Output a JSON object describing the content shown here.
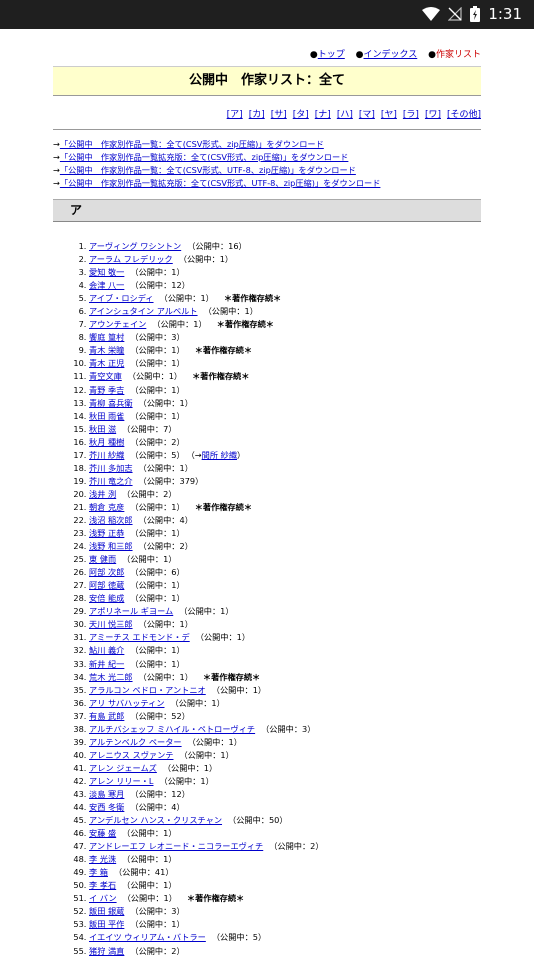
{
  "status_bar": {
    "time": "1:31",
    "icons": [
      "wifi-icon",
      "no-signal-icon",
      "battery-icon"
    ]
  },
  "topnav": [
    {
      "label": "トップ",
      "link": true
    },
    {
      "label": "インデックス",
      "link": true
    },
    {
      "label": "作家リスト",
      "link": false
    }
  ],
  "bullet": "●",
  "title": "公開中　作家リスト：全て",
  "kana": [
    "[ア]",
    "[カ]",
    "[サ]",
    "[タ]",
    "[ナ]",
    "[ハ]",
    "[マ]",
    "[ヤ]",
    "[ラ]",
    "[ワ]",
    "[その他]"
  ],
  "downloads": [
    {
      "arrow": "→",
      "text": "「公開中　作家別作品一覧：全て(CSV形式、zip圧縮)」をダウンロード"
    },
    {
      "arrow": "→",
      "text": "「公開中　作家別作品一覧拡充版：全て(CSV形式、zip圧縮)」をダウンロード"
    },
    {
      "arrow": "→",
      "text": "「公開中　作家別作品一覧：全て(CSV形式、UTF-8、zip圧縮)」をダウンロード"
    },
    {
      "arrow": "→",
      "text": "「公開中　作家別作品一覧拡充版：全て(CSV形式、UTF-8、zip圧縮)」をダウンロード"
    }
  ],
  "section_title": "ア",
  "authors": [
    {
      "name": "アーヴィング ワシントン",
      "count": "（公開中：16）"
    },
    {
      "name": "アーラム フレデリック",
      "count": "（公開中：1）"
    },
    {
      "name": "愛知 敬一",
      "count": "（公開中：1）"
    },
    {
      "name": "会津 八一",
      "count": "（公開中：12）"
    },
    {
      "name": "アイブ・ロシディ",
      "count": "（公開中：1）",
      "note": "＊著作権存続＊"
    },
    {
      "name": "アインシュタイン アルベルト",
      "count": "（公開中：1）"
    },
    {
      "name": "アウンチェイン",
      "count": "（公開中：1）",
      "note": "＊著作権存続＊"
    },
    {
      "name": "饗庭 篁村",
      "count": "（公開中：3）"
    },
    {
      "name": "青木 栄瞳",
      "count": "（公開中：1）",
      "note": "＊著作権存続＊"
    },
    {
      "name": "青木 正児",
      "count": "（公開中：1）"
    },
    {
      "name": "青空文庫",
      "count": "（公開中：1）",
      "note": "＊著作権存続＊"
    },
    {
      "name": "青野 季吉",
      "count": "（公開中：1）"
    },
    {
      "name": "青柳 喜兵衛",
      "count": "（公開中：1）"
    },
    {
      "name": "秋田 雨雀",
      "count": "（公開中：1）"
    },
    {
      "name": "秋田 滋",
      "count": "（公開中：7）"
    },
    {
      "name": "秋月 種樹",
      "count": "（公開中：2）"
    },
    {
      "name": "芥川 紗織",
      "count": "（公開中：5）",
      "ref_prefix": "（→",
      "ref": "間所 紗織",
      "ref_suffix": "）"
    },
    {
      "name": "芥川 多加志",
      "count": "（公開中：1）"
    },
    {
      "name": "芥川 竜之介",
      "count": "（公開中：379）"
    },
    {
      "name": "浅井 洌",
      "count": "（公開中：2）"
    },
    {
      "name": "朝倉 克彦",
      "count": "（公開中：1）",
      "note": "＊著作権存続＊"
    },
    {
      "name": "浅沼 稲次郎",
      "count": "（公開中：4）"
    },
    {
      "name": "浅野 正恭",
      "count": "（公開中：1）"
    },
    {
      "name": "浅野 和三郎",
      "count": "（公開中：2）"
    },
    {
      "name": "東 健而",
      "count": "（公開中：1）"
    },
    {
      "name": "阿部 次郎",
      "count": "（公開中：6）"
    },
    {
      "name": "阿部 徳蔵",
      "count": "（公開中：1）"
    },
    {
      "name": "安倍 能成",
      "count": "（公開中：1）"
    },
    {
      "name": "アポリネール ギヨーム",
      "count": "（公開中：1）"
    },
    {
      "name": "天川 悦三郎",
      "count": "（公開中：1）"
    },
    {
      "name": "アミーチス エドモンド・デ",
      "count": "（公開中：1）"
    },
    {
      "name": "鮎川 義介",
      "count": "（公開中：1）"
    },
    {
      "name": "新井 紀一",
      "count": "（公開中：1）"
    },
    {
      "name": "荒木 光二郎",
      "count": "（公開中：1）",
      "note": "＊著作権存続＊"
    },
    {
      "name": "アラルコン ペドロ・アントニオ",
      "count": "（公開中：1）"
    },
    {
      "name": "アリ サバハッティン",
      "count": "（公開中：1）"
    },
    {
      "name": "有島 武郎",
      "count": "（公開中：52）"
    },
    {
      "name": "アルチバシェッフ ミハイル・ペトローヴィチ",
      "count": "（公開中：3）"
    },
    {
      "name": "アルテンベルク ペーター",
      "count": "（公開中：1）"
    },
    {
      "name": "アレニウス スヴァンテ",
      "count": "（公開中：1）"
    },
    {
      "name": "アレン ジェームズ",
      "count": "（公開中：1）"
    },
    {
      "name": "アレン リリー・L",
      "count": "（公開中：1）"
    },
    {
      "name": "淡島 寒月",
      "count": "（公開中：12）"
    },
    {
      "name": "安西 冬衛",
      "count": "（公開中：4）"
    },
    {
      "name": "アンデルセン ハンス・クリスチャン",
      "count": "（公開中：50）"
    },
    {
      "name": "安藤 盛",
      "count": "（公開中：1）"
    },
    {
      "name": "アンドレーエフ レオニード・ニコラーエヴィチ",
      "count": "（公開中：2）"
    },
    {
      "name": "李 光洙",
      "count": "（公開中：1）"
    },
    {
      "name": "李 箱",
      "count": "（公開中：41）"
    },
    {
      "name": "李 孝石",
      "count": "（公開中：1）"
    },
    {
      "name": "イ バン",
      "count": "（公開中：1）",
      "note": "＊著作権存続＊"
    },
    {
      "name": "飯田 銀蔵",
      "count": "（公開中：3）"
    },
    {
      "name": "飯田 平作",
      "count": "（公開中：1）"
    },
    {
      "name": "イエイツ ウィリアム・バトラー",
      "count": "（公開中：5）"
    },
    {
      "name": "猪狩 満直",
      "count": "（公開中：2）"
    }
  ]
}
